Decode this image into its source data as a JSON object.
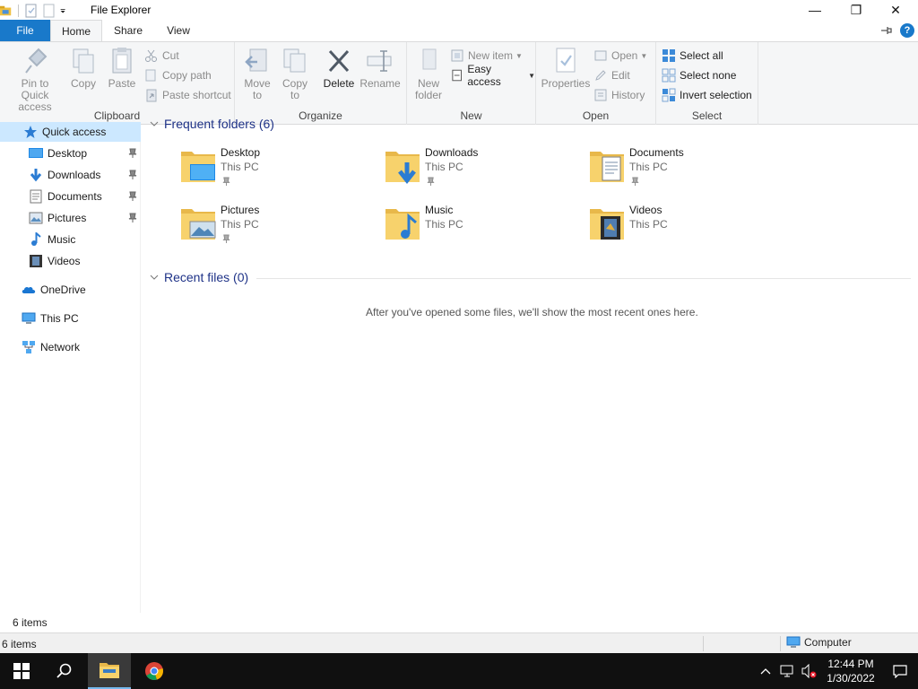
{
  "window": {
    "title": "File Explorer",
    "minimize_glyph": "—",
    "restore_glyph": "❐",
    "close_glyph": "✕"
  },
  "tabs": [
    {
      "label": "File"
    },
    {
      "label": "Home"
    },
    {
      "label": "Share"
    },
    {
      "label": "View"
    }
  ],
  "help_glyph": "?",
  "ribbon": {
    "clipboard": {
      "label": "Clipboard",
      "pin": "Pin to Quick access",
      "copy": "Copy",
      "paste": "Paste",
      "cut": "Cut",
      "copy_path": "Copy path",
      "paste_shortcut": "Paste shortcut"
    },
    "organize": {
      "label": "Organize",
      "move_to": "Move to",
      "copy_to": "Copy to",
      "delete": "Delete",
      "rename": "Rename"
    },
    "new": {
      "label": "New",
      "new_folder": "New folder",
      "new_item": "New item",
      "easy_access": "Easy access"
    },
    "open": {
      "label": "Open",
      "properties": "Properties",
      "open": "Open",
      "edit": "Edit",
      "history": "History"
    },
    "select": {
      "label": "Select",
      "select_all": "Select all",
      "select_none": "Select none",
      "invert_selection": "Invert selection"
    }
  },
  "nav": {
    "quick_access": "Quick access",
    "items": [
      {
        "label": "Desktop",
        "icon": "desktop-icon",
        "pinned": true
      },
      {
        "label": "Downloads",
        "icon": "downloads-icon",
        "pinned": true
      },
      {
        "label": "Documents",
        "icon": "documents-icon",
        "pinned": true
      },
      {
        "label": "Pictures",
        "icon": "pictures-icon",
        "pinned": true
      },
      {
        "label": "Music",
        "icon": "music-icon",
        "pinned": false
      },
      {
        "label": "Videos",
        "icon": "videos-icon",
        "pinned": false
      }
    ],
    "onedrive": "OneDrive",
    "this_pc": "This PC",
    "network": "Network"
  },
  "content": {
    "frequent_header": "Frequent folders (6)",
    "recent_header": "Recent files (0)",
    "empty_message": "After you've opened some files, we'll show the most recent ones here.",
    "folders": [
      {
        "name": "Desktop",
        "location": "This PC",
        "pinned": true
      },
      {
        "name": "Downloads",
        "location": "This PC",
        "pinned": true
      },
      {
        "name": "Documents",
        "location": "This PC",
        "pinned": true
      },
      {
        "name": "Pictures",
        "location": "This PC",
        "pinned": true
      },
      {
        "name": "Music",
        "location": "This PC",
        "pinned": false
      },
      {
        "name": "Videos",
        "location": "This PC",
        "pinned": false
      }
    ]
  },
  "status": {
    "item_count": "6 items",
    "item_count_bottom": "6 items",
    "computer": "Computer"
  },
  "taskbar": {
    "time": "12:44 PM",
    "date": "1/30/2022"
  },
  "colors": {
    "accent": "#1979ca",
    "folder": "#f7d26c",
    "selection": "#cce8ff",
    "section_header": "#1e3287",
    "taskbar": "#101010"
  }
}
